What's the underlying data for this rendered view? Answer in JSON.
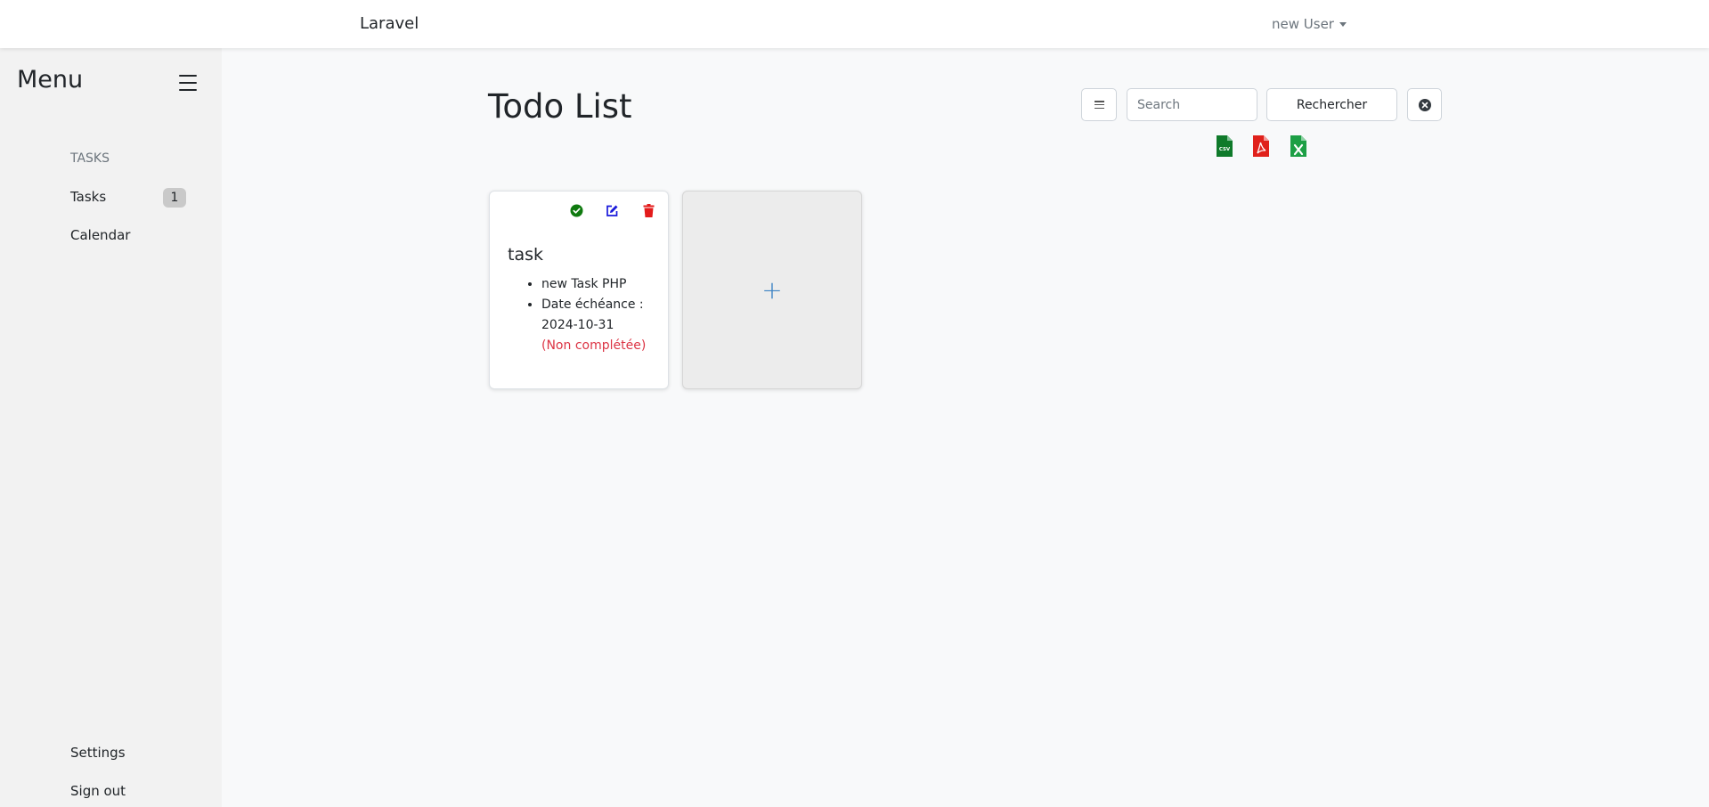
{
  "navbar": {
    "brand": "Laravel",
    "user": "new User"
  },
  "sidebar": {
    "title": "Menu",
    "section_heading": "TASKS",
    "items": [
      {
        "label": "Tasks",
        "badge": "1"
      },
      {
        "label": "Calendar"
      }
    ],
    "footer_items": [
      {
        "label": "Settings"
      },
      {
        "label": "Sign out"
      }
    ]
  },
  "main": {
    "title": "Todo List",
    "search": {
      "placeholder": "Search",
      "value": "",
      "button_label": "Rechercher"
    },
    "export_icons": [
      "csv-file-icon",
      "pdf-file-icon",
      "excel-file-icon"
    ],
    "tasks": [
      {
        "title": "task",
        "description": "new Task PHP",
        "due_label": "Date échéance :",
        "due_date": "2024-10-31",
        "status": "(Non complétée)"
      }
    ],
    "add_label": "+"
  },
  "colors": {
    "complete": "#0f7a0f",
    "edit": "#1a1adb",
    "delete": "#e31b1b",
    "status_incomplete": "#dc3545",
    "csv": "#0f7a2a",
    "pdf": "#e0211b",
    "excel": "#1d9f45",
    "add_plus": "#3b82c4"
  }
}
